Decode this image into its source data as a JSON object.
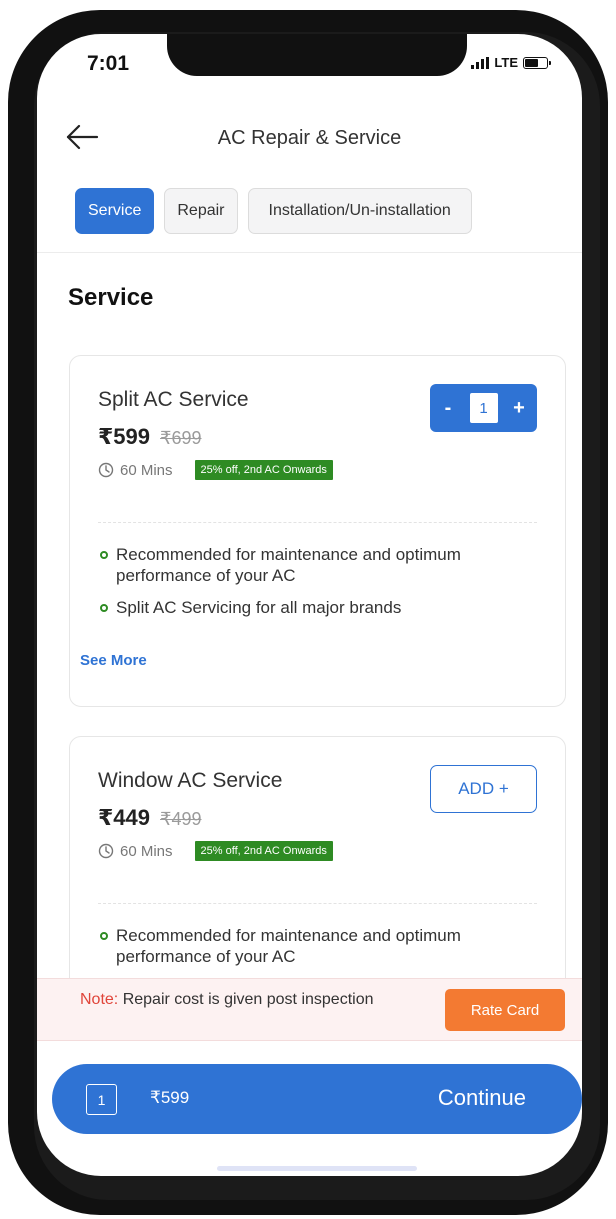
{
  "status_bar": {
    "time": "7:01",
    "network": "LTE"
  },
  "header": {
    "title": "AC Repair & Service"
  },
  "tabs": [
    {
      "label": "Service",
      "active": true
    },
    {
      "label": "Repair",
      "active": false
    },
    {
      "label": "Installation/Un-installation",
      "active": false
    }
  ],
  "section_title": "Service",
  "services": [
    {
      "name": "Split AC Service",
      "price": "₹599",
      "original_price": "₹699",
      "duration": "60 Mins",
      "offer": "25% off, 2nd AC Onwards",
      "quantity": "1",
      "features": [
        "Recommended for maintenance and optimum performance of your AC",
        "Split AC Servicing for all major brands"
      ],
      "see_more": "See More"
    },
    {
      "name": "Window AC Service",
      "price": "₹449",
      "original_price": "₹499",
      "duration": "60 Mins",
      "offer": "25% off, 2nd AC Onwards",
      "add_label": "ADD +",
      "features": [
        "Recommended for maintenance and optimum performance of your AC"
      ]
    }
  ],
  "stepper": {
    "minus": "-",
    "plus": "+"
  },
  "note": {
    "label": "Note:",
    "text": " Repair cost is given post inspection",
    "button": "Rate Card"
  },
  "cart": {
    "count": "1",
    "total": "₹599",
    "continue_label": "Continue"
  },
  "colors": {
    "primary": "#2f73d4",
    "offer_green": "#2e8b23",
    "rate_card_orange": "#f37a32",
    "note_red": "#e0453a"
  }
}
